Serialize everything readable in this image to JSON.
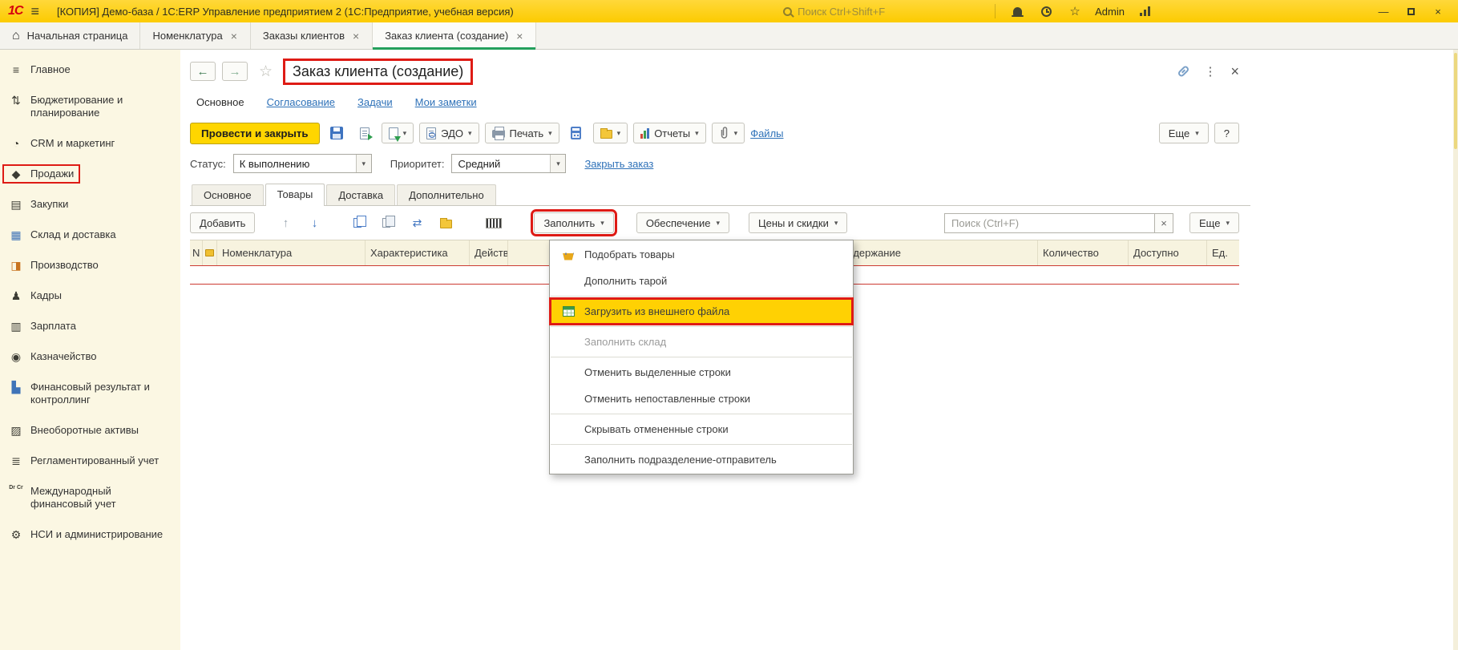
{
  "titlebar": {
    "logo": "1С",
    "title": "[КОПИЯ] Демо-база / 1С:ERP Управление предприятием 2  (1С:Предприятие, учебная версия)",
    "search_placeholder": "Поиск Ctrl+Shift+F",
    "user": "Admin"
  },
  "tabbar": {
    "home_label": "Начальная страница",
    "tabs": [
      {
        "label": "Номенклатура"
      },
      {
        "label": "Заказы клиентов"
      },
      {
        "label": "Заказ клиента (создание)"
      }
    ]
  },
  "sidebar": {
    "items": [
      {
        "label": "Главное",
        "icon": "≡"
      },
      {
        "label": "Бюджетирование и планирование",
        "icon": "⇅"
      },
      {
        "label": "CRM и маркетинг",
        "icon": "◔"
      },
      {
        "label": "Продажи",
        "icon": "◆"
      },
      {
        "label": "Закупки",
        "icon": "▤"
      },
      {
        "label": "Склад и доставка",
        "icon": "▦"
      },
      {
        "label": "Производство",
        "icon": "◨"
      },
      {
        "label": "Кадры",
        "icon": "♟"
      },
      {
        "label": "Зарплата",
        "icon": "▥"
      },
      {
        "label": "Казначейство",
        "icon": "◉"
      },
      {
        "label": "Финансовый результат и контроллинг",
        "icon": "▙"
      },
      {
        "label": "Внеоборотные активы",
        "icon": "▨"
      },
      {
        "label": "Регламентированный учет",
        "icon": "≣"
      },
      {
        "label": "Международный финансовый учет",
        "icon": "Dr Cr"
      },
      {
        "label": "НСИ и администрирование",
        "icon": "⚙"
      }
    ]
  },
  "page": {
    "title": "Заказ клиента (создание)",
    "nav_links": [
      {
        "label": "Основное"
      },
      {
        "label": "Согласование"
      },
      {
        "label": "Задачи"
      },
      {
        "label": "Мои заметки"
      }
    ],
    "commands": {
      "post_and_close": "Провести и закрыть",
      "edo": "ЭДО",
      "print": "Печать",
      "reports": "Отчеты",
      "files": "Файлы",
      "more": "Еще",
      "help": "?"
    },
    "status": {
      "status_label": "Статус:",
      "status_value": "К выполнению",
      "priority_label": "Приоритет:",
      "priority_value": "Средний",
      "close_order": "Закрыть заказ"
    },
    "subtabs": [
      {
        "label": "Основное"
      },
      {
        "label": "Товары"
      },
      {
        "label": "Доставка"
      },
      {
        "label": "Дополнительно"
      }
    ],
    "items_toolbar": {
      "add": "Добавить",
      "fill": "Заполнить",
      "supply": "Обеспечение",
      "prices": "Цены и скидки",
      "search_placeholder": "Поиск (Ctrl+F)",
      "more": "Еще"
    },
    "table": {
      "columns": [
        "N",
        "Номенклатура",
        "Характеристика",
        "Действия",
        "Содержание",
        "Количество",
        "Доступно",
        "Ед."
      ]
    },
    "fill_menu": {
      "items": [
        {
          "label": "Подобрать товары"
        },
        {
          "label": "Дополнить тарой"
        },
        {
          "label": "Загрузить из внешнего файла"
        },
        {
          "label": "Заполнить склад"
        },
        {
          "label": "Отменить выделенные строки"
        },
        {
          "label": "Отменить непоставленные строки"
        },
        {
          "label": "Скрывать отмененные строки"
        },
        {
          "label": "Заполнить подразделение-отправитель"
        }
      ]
    }
  },
  "icons": {
    "hamburger": "≡",
    "home": "⌂",
    "star": "☆",
    "back": "←",
    "forward": "→",
    "dots": "⋮",
    "close": "×",
    "minimize": "—",
    "dropdown": "▾",
    "up": "↑",
    "down": "↓",
    "swap": "⇄"
  },
  "colors": {
    "brand_yellow": "#ffd600",
    "annotation_red": "#de1b15",
    "active_tab_green": "#24a05c",
    "link_blue": "#2e71b8"
  }
}
